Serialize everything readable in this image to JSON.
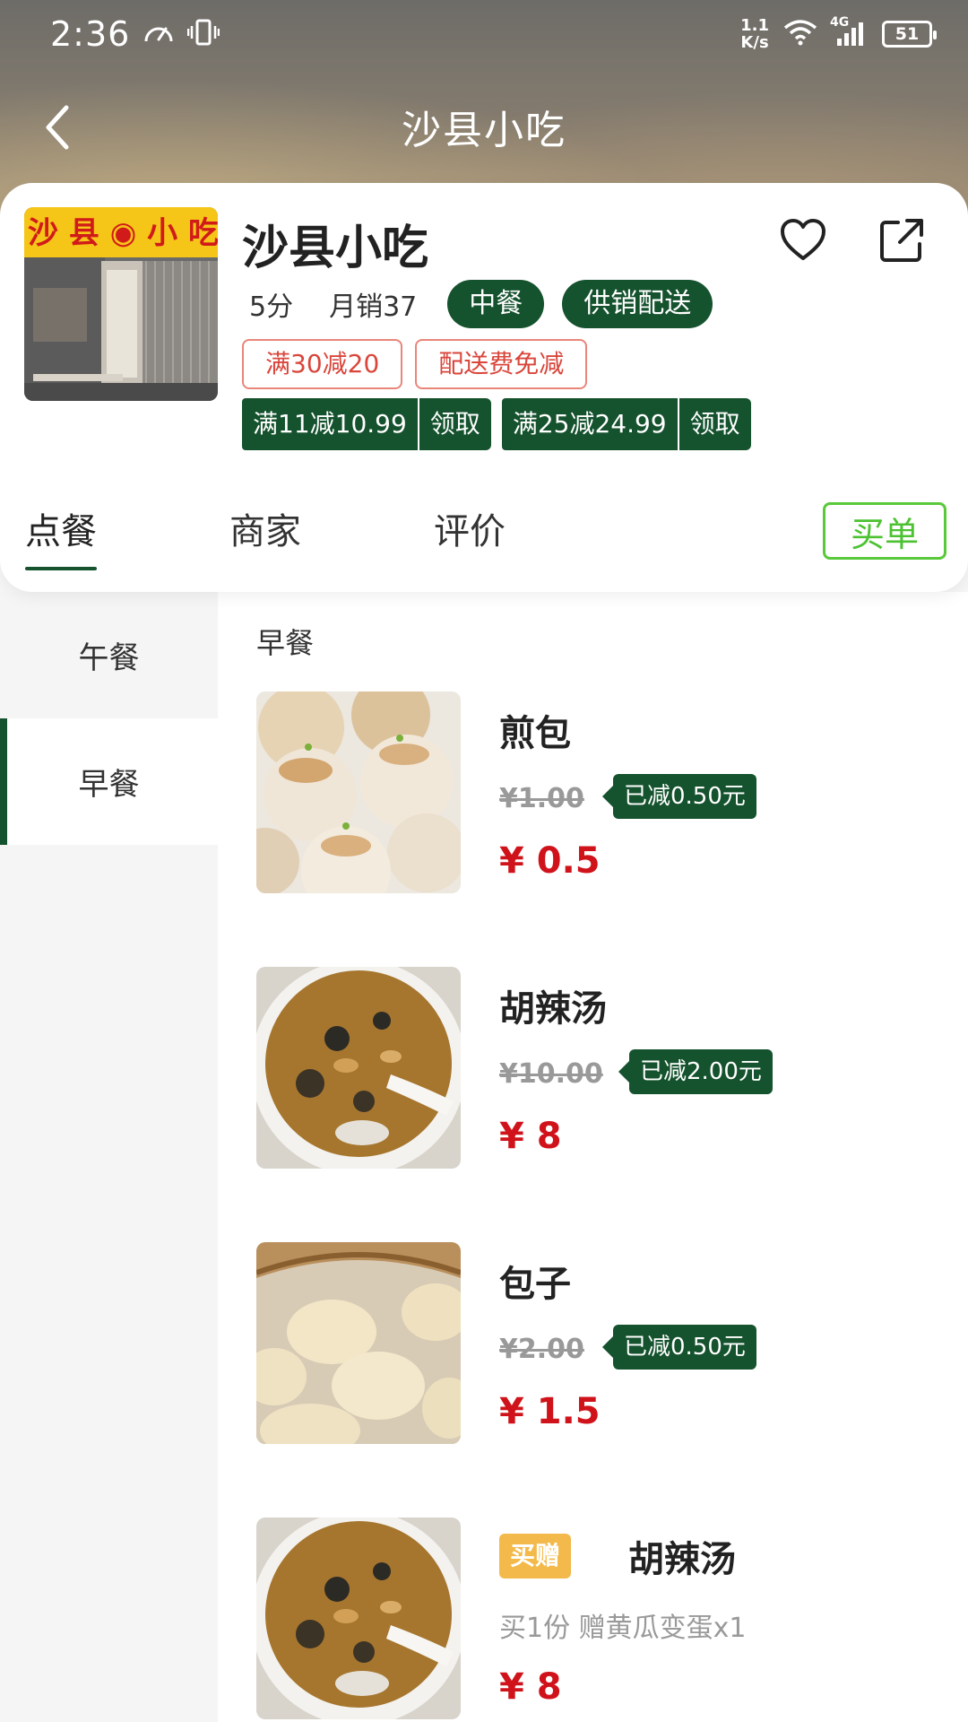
{
  "status_bar": {
    "time": "2:36",
    "net_speed_top": "1.1",
    "net_speed_bottom": "K/s",
    "network": "4G",
    "battery": "51"
  },
  "nav": {
    "title": "沙县小吃"
  },
  "store": {
    "name": "沙县小吃",
    "rating": "5分",
    "monthly_sales": "月销37",
    "tags": [
      "中餐",
      "供销配送"
    ],
    "promos": [
      "满30减20",
      "配送费免减"
    ],
    "coupons": [
      {
        "amount": "满11减10.99",
        "action": "领取"
      },
      {
        "amount": "满25减24.99",
        "action": "领取"
      }
    ],
    "photo_sign": "沙县小吃"
  },
  "tabs": {
    "items": [
      "点餐",
      "商家",
      "评价"
    ],
    "active": "点餐",
    "buy_button": "买单"
  },
  "categories": {
    "items": [
      "午餐",
      "早餐"
    ],
    "active": "早餐"
  },
  "section": {
    "title": "早餐"
  },
  "products": [
    {
      "name": "煎包",
      "original_price": "¥1.00",
      "discount": "已减0.50元",
      "price": "¥ 0.5"
    },
    {
      "name": "胡辣汤",
      "original_price": "¥10.00",
      "discount": "已减2.00元",
      "price": "¥ 8"
    },
    {
      "name": "包子",
      "original_price": "¥2.00",
      "discount": "已减0.50元",
      "price": "¥ 1.5"
    }
  ],
  "gift_product": {
    "badge": "买赠",
    "name": "胡辣汤",
    "description": "买1份 赠黄瓜变蛋x1",
    "price": "¥ 8"
  },
  "colors": {
    "brand_green": "#15522e",
    "price_red": "#d0131b",
    "buy_green": "#4cc232",
    "promo_red": "#d9463b",
    "gift_yellow": "#f3b94a"
  }
}
